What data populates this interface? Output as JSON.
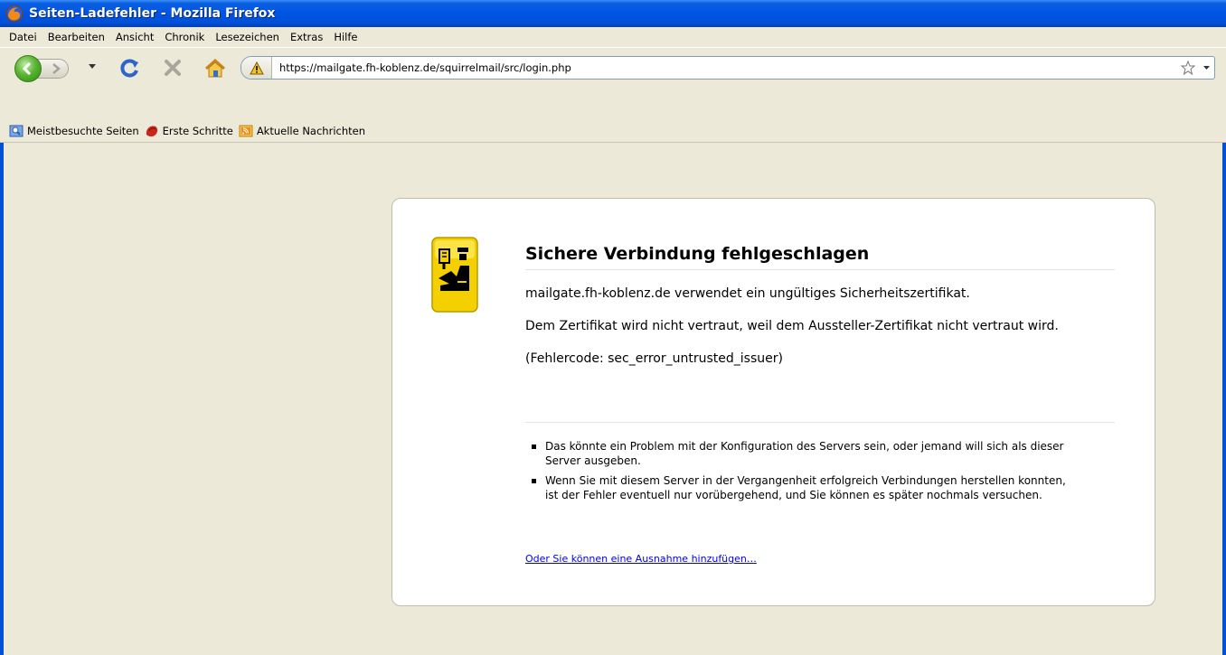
{
  "window": {
    "title": "Seiten-Ladefehler - Mozilla Firefox",
    "icon": "firefox-icon"
  },
  "menu": [
    "Datei",
    "Bearbeiten",
    "Ansicht",
    "Chronik",
    "Lesezeichen",
    "Extras",
    "Hilfe"
  ],
  "toolbar": {
    "url": "https://mailgate.fh-koblenz.de/squirrelmail/src/login.php",
    "icons": [
      "back-icon",
      "forward-icon",
      "reload-icon",
      "stop-icon",
      "home-icon",
      "warning-icon",
      "star-icon"
    ]
  },
  "bookmarks": [
    {
      "label": "Meistbesuchte Seiten",
      "icon": "smart-folder-icon"
    },
    {
      "label": "Erste Schritte",
      "icon": "firefox-red-icon"
    },
    {
      "label": "Aktuelle Nachrichten",
      "icon": "rss-icon"
    }
  ],
  "error": {
    "title": "Sichere Verbindung fehlgeschlagen",
    "paragraphs": [
      "mailgate.fh-koblenz.de verwendet ein ungültiges Sicherheitszertifikat.",
      "Dem Zertifikat wird nicht vertraut, weil dem Aussteller-Zertifikat nicht vertraut wird.",
      "(Fehlercode: sec_error_untrusted_issuer)"
    ],
    "bullets": [
      "Das könnte ein Problem mit der Konfiguration des Servers sein, oder jemand will sich als dieser Server ausgeben.",
      "Wenn Sie mit diesem Server in der Vergangenheit erfolgreich Verbindungen herstellen konnten, ist der Fehler eventuell nur vorübergehend, und Sie können es später nochmals versuchen."
    ],
    "link": "Oder Sie können eine Ausnahme hinzufügen…",
    "icon": "security-officer-icon"
  },
  "colors": {
    "titlebar": "#0054e3",
    "chrome": "#ece9d8",
    "link": "#0000ee",
    "icon_yellow": "#f5d000"
  }
}
